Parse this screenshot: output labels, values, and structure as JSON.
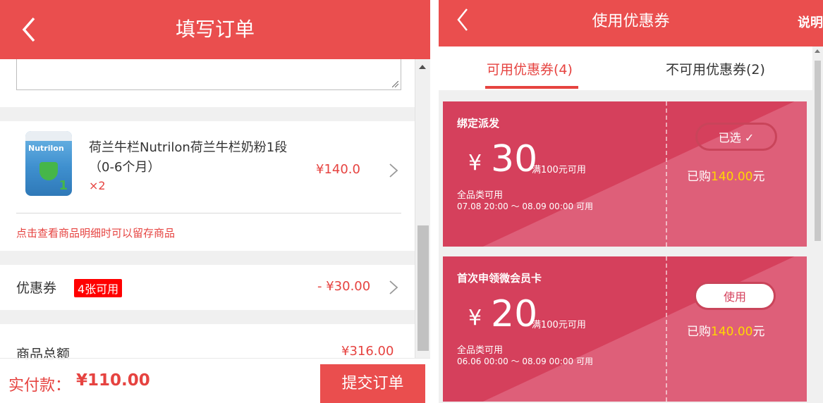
{
  "left": {
    "header": {
      "title": "填写订单"
    },
    "product": {
      "name": "荷兰牛栏Nutrilon荷兰牛栏奶粉1段（0-6个月）",
      "image_brand": "Nutrilon",
      "image_stage": "1",
      "quantity": "×2",
      "price": "¥140.0"
    },
    "hint": "点击查看商品明细时可以留存商品",
    "coupon_row": {
      "label": "优惠券",
      "badge": "4张可用",
      "value": "- ¥30.00"
    },
    "total_row": {
      "label": "商品总额",
      "value": "¥316.00"
    },
    "bottom": {
      "pay_label": "实付款：",
      "pay_amount": "¥110.00",
      "submit": "提交订单"
    }
  },
  "right": {
    "header": {
      "title": "使用优惠券",
      "help": "说明"
    },
    "tabs": [
      {
        "label": "可用优惠券(4)",
        "active": true
      },
      {
        "label": "不可用优惠券(2)",
        "active": false
      }
    ],
    "coupons": [
      {
        "title": "绑定派发",
        "currency": "¥",
        "amount": "30",
        "condition": "满100元可用",
        "scope": "全品类可用",
        "validity": "07.08 20:00 ～ 08.09 00:00 可用",
        "action": "已选 ✓",
        "bought_prefix": "已购",
        "bought_amount": "140.00",
        "bought_suffix": "元"
      },
      {
        "title": "首次申领微会员卡",
        "currency": "¥",
        "amount": "20",
        "condition": "满100元可用",
        "scope": "全品类可用",
        "validity": "06.06 00:00 ～ 08.09 00:00 可用",
        "action": "使用",
        "bought_prefix": "已购",
        "bought_amount": "140.00",
        "bought_suffix": "元"
      }
    ]
  },
  "colors": {
    "brand_red": "#ea4e4e",
    "coupon_red": "#d5405c",
    "highlight_yellow": "#ffd800",
    "price_red": "#e64340"
  }
}
